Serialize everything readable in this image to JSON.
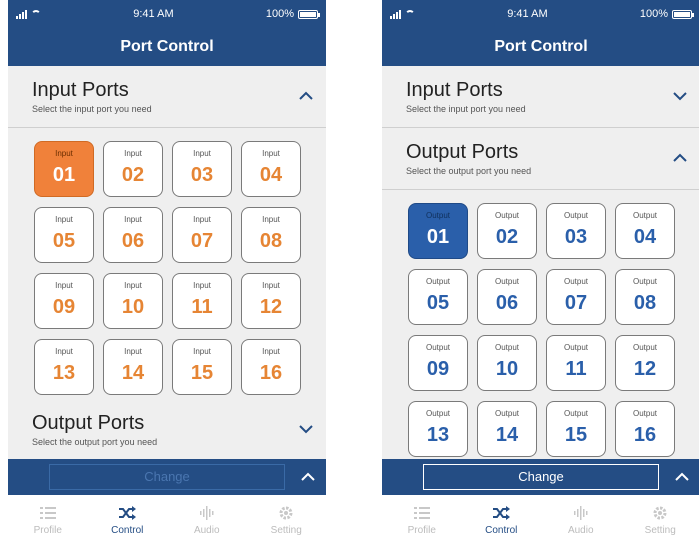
{
  "status": {
    "time": "9:41 AM",
    "battery": "100%"
  },
  "title": "Port Control",
  "left": {
    "input": {
      "title": "Input Ports",
      "subtitle": "Select the input port you need"
    },
    "output": {
      "title": "Output Ports",
      "subtitle": "Select the output port you need"
    },
    "port_label": "Input",
    "ports": [
      "01",
      "02",
      "03",
      "04",
      "05",
      "06",
      "07",
      "08",
      "09",
      "10",
      "11",
      "12",
      "13",
      "14",
      "15",
      "16"
    ],
    "selected": "01",
    "change": "Change"
  },
  "right": {
    "input": {
      "title": "Input Ports",
      "subtitle": "Select the input port you need"
    },
    "output": {
      "title": "Output Ports",
      "subtitle": "Select the output port you need"
    },
    "port_label": "Output",
    "ports": [
      "01",
      "02",
      "03",
      "04",
      "05",
      "06",
      "07",
      "08",
      "09",
      "10",
      "11",
      "12",
      "13",
      "14",
      "15",
      "16"
    ],
    "selected": "01",
    "change": "Change"
  },
  "tabs": [
    {
      "label": "Profile",
      "icon": "list-icon"
    },
    {
      "label": "Control",
      "icon": "shuffle-icon"
    },
    {
      "label": "Audio",
      "icon": "audio-wave-icon"
    },
    {
      "label": "Setting",
      "icon": "gear-icon"
    }
  ],
  "active_tab": "Control",
  "colors": {
    "header": "#244d84",
    "input_accent": "#f0813a",
    "output_accent": "#2a5faa"
  }
}
